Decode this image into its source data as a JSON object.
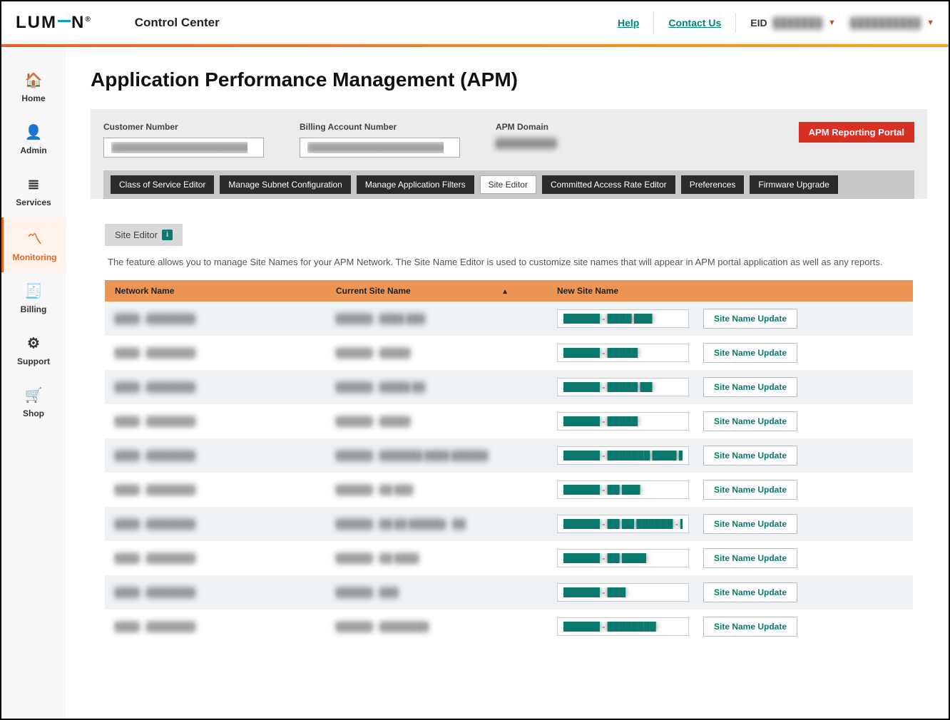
{
  "header": {
    "logo_text": "LUM=N",
    "product": "Control Center",
    "help": "Help",
    "contact": "Contact Us",
    "eid_label": "EID",
    "eid_value": "███████",
    "user_value": "██████████"
  },
  "sidebar": {
    "items": [
      {
        "label": "Home",
        "icon": "🏠"
      },
      {
        "label": "Admin",
        "icon": "👤"
      },
      {
        "label": "Services",
        "icon": "≣"
      },
      {
        "label": "Monitoring",
        "icon": "〽"
      },
      {
        "label": "Billing",
        "icon": "🧾"
      },
      {
        "label": "Support",
        "icon": "⚙"
      },
      {
        "label": "Shop",
        "icon": "🛒"
      }
    ]
  },
  "page": {
    "title": "Application Performance Management (APM)"
  },
  "filters": {
    "customer_label": "Customer Number",
    "customer_value": "████████████████████████",
    "billing_label": "Billing Account Number",
    "billing_value": "████████████████████████",
    "domain_label": "APM Domain",
    "domain_value": "██████████",
    "portal_btn": "APM Reporting Portal"
  },
  "tabs": [
    "Class of Service Editor",
    "Manage Subnet Configuration",
    "Manage Application Filters",
    "Site Editor",
    "Committed Access Rate Editor",
    "Preferences",
    "Firmware Upgrade"
  ],
  "active_tab": "Site Editor",
  "editor": {
    "badge": "Site Editor",
    "desc": "The feature allows you to manage Site Names for your APM Network. The Site Name Editor is used to customize site names that will appear in APM portal application as well as any reports.",
    "cols": {
      "network": "Network Name",
      "current": "Current Site Name",
      "new": "New Site Name"
    },
    "update_label": "Site Name Update",
    "rows": [
      {
        "network": "████ - ████████",
        "current": "██████ - ████ ███",
        "new": "██████ - ████ ███"
      },
      {
        "network": "████ - ████████",
        "current": "██████ - █████",
        "new": "██████ - █████"
      },
      {
        "network": "████ - ████████",
        "current": "██████ - █████ ██",
        "new": "██████ - █████ ██"
      },
      {
        "network": "████ - ████████",
        "current": "██████ - █████",
        "new": "██████ - █████"
      },
      {
        "network": "████ - ████████",
        "current": "██████ - ███████ ████ ██████",
        "new": "██████ - ███████ ████ ██████"
      },
      {
        "network": "████ - ████████",
        "current": "██████ - ██ ███",
        "new": "██████ - ██ ███"
      },
      {
        "network": "████ - ████████",
        "current": "██████ - ██ ██ ██████ - ██",
        "new": "██████ - ██ ██ ██████ - ██"
      },
      {
        "network": "████ - ████████",
        "current": "██████ - ██ ████",
        "new": "██████ - ██ ████"
      },
      {
        "network": "████ - ████████",
        "current": "██████ - ███",
        "new": "██████ - ███"
      },
      {
        "network": "████ - ████████",
        "current": "██████ - ████████",
        "new": "██████ - ████████"
      }
    ]
  }
}
